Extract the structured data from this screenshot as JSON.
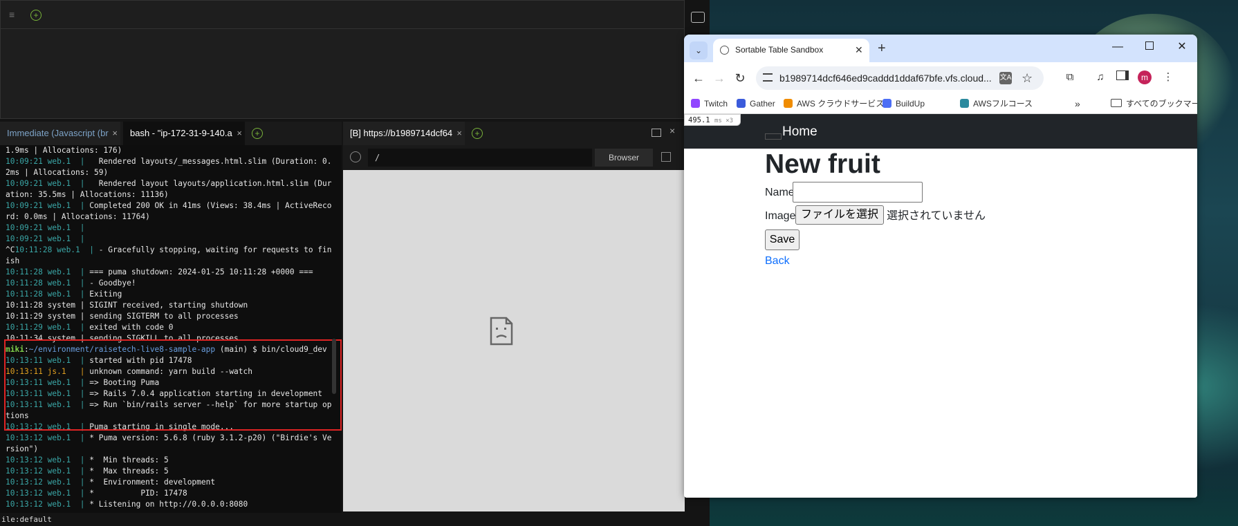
{
  "ide": {
    "terminal_tabs": [
      {
        "label": "Immediate (Javascript (br"
      },
      {
        "label": "bash - \"ip-172-31-9-140.a"
      }
    ],
    "close_glyph": "×",
    "add_glyph": "+",
    "menu_glyph": "≡",
    "status_text": "ile:default"
  },
  "terminal_lines": [
    {
      "parts": [
        {
          "t": "1.9ms | Allocations: 176)",
          "c": ""
        }
      ]
    },
    {
      "parts": [
        {
          "t": "10:09:21 web.1  | ",
          "c": "tcyan"
        },
        {
          "t": "  Rendered layouts/_messages.html.slim (Duration: 0.",
          "c": ""
        }
      ]
    },
    {
      "parts": [
        {
          "t": "2ms | Allocations: 59)",
          "c": ""
        }
      ]
    },
    {
      "parts": [
        {
          "t": "10:09:21 web.1  | ",
          "c": "tcyan"
        },
        {
          "t": "  Rendered layout layouts/application.html.slim (Dur",
          "c": ""
        }
      ]
    },
    {
      "parts": [
        {
          "t": "ation: 35.5ms | Allocations: 11136)",
          "c": ""
        }
      ]
    },
    {
      "parts": [
        {
          "t": "10:09:21 web.1  | ",
          "c": "tcyan"
        },
        {
          "t": "Completed 200 OK in 41ms (Views: 38.4ms | ActiveReco",
          "c": ""
        }
      ]
    },
    {
      "parts": [
        {
          "t": "rd: 0.0ms | Allocations: 11764)",
          "c": ""
        }
      ]
    },
    {
      "parts": [
        {
          "t": "10:09:21 web.1  |",
          "c": "tcyan"
        }
      ]
    },
    {
      "parts": [
        {
          "t": "10:09:21 web.1  |",
          "c": "tcyan"
        }
      ]
    },
    {
      "parts": [
        {
          "t": "^C",
          "c": ""
        },
        {
          "t": "10:11:28 web.1  | ",
          "c": "tcyan"
        },
        {
          "t": "- Gracefully stopping, waiting for requests to fin",
          "c": ""
        }
      ]
    },
    {
      "parts": [
        {
          "t": "ish",
          "c": ""
        }
      ]
    },
    {
      "parts": [
        {
          "t": "10:11:28 web.1  | ",
          "c": "tcyan"
        },
        {
          "t": "=== puma shutdown: 2024-01-25 10:11:28 +0000 ===",
          "c": ""
        }
      ]
    },
    {
      "parts": [
        {
          "t": "10:11:28 web.1  | ",
          "c": "tcyan"
        },
        {
          "t": "- Goodbye!",
          "c": ""
        }
      ]
    },
    {
      "parts": [
        {
          "t": "10:11:28 web.1  | ",
          "c": "tcyan"
        },
        {
          "t": "Exiting",
          "c": ""
        }
      ]
    },
    {
      "parts": [
        {
          "t": "10:11:28 system | SIGINT received, starting shutdown",
          "c": ""
        }
      ]
    },
    {
      "parts": [
        {
          "t": "10:11:29 system | sending SIGTERM to all processes",
          "c": ""
        }
      ]
    },
    {
      "parts": [
        {
          "t": "10:11:29 web.1  | ",
          "c": "tcyan"
        },
        {
          "t": "exited with code 0",
          "c": ""
        }
      ]
    },
    {
      "parts": [
        {
          "t": "10:11:34 system | sending SIGKILL to all processes",
          "c": ""
        }
      ]
    },
    {
      "parts": [
        {
          "t": "miki",
          "c": "tgreen"
        },
        {
          "t": ":",
          "c": ""
        },
        {
          "t": "~/environment/raisetech-live8-sample-app",
          "c": "tblue"
        },
        {
          "t": " (main) $ bin/cloud9_dev",
          "c": ""
        }
      ]
    },
    {
      "parts": [
        {
          "t": "10:13:11 web.1  | ",
          "c": "tcyan"
        },
        {
          "t": "started with pid 17478",
          "c": ""
        }
      ]
    },
    {
      "parts": [
        {
          "t": "10:13:11 js.1   | ",
          "c": "torange"
        },
        {
          "t": "unknown command: yarn build --watch",
          "c": ""
        }
      ]
    },
    {
      "parts": [
        {
          "t": "10:13:11 web.1  | ",
          "c": "tcyan"
        },
        {
          "t": "=> Booting Puma",
          "c": ""
        }
      ]
    },
    {
      "parts": [
        {
          "t": "10:13:11 web.1  | ",
          "c": "tcyan"
        },
        {
          "t": "=> Rails 7.0.4 application starting in development",
          "c": ""
        }
      ]
    },
    {
      "parts": [
        {
          "t": "10:13:11 web.1  | ",
          "c": "tcyan"
        },
        {
          "t": "=> Run `bin/rails server --help` for more startup op",
          "c": ""
        }
      ]
    },
    {
      "parts": [
        {
          "t": "tions",
          "c": ""
        }
      ]
    },
    {
      "parts": [
        {
          "t": "10:13:12 web.1  | ",
          "c": "tcyan"
        },
        {
          "t": "Puma starting in single mode...",
          "c": ""
        }
      ]
    },
    {
      "parts": [
        {
          "t": "10:13:12 web.1  | ",
          "c": "tcyan"
        },
        {
          "t": "* Puma version: 5.6.8 (ruby 3.1.2-p20) (\"Birdie's Ve",
          "c": ""
        }
      ]
    },
    {
      "parts": [
        {
          "t": "rsion\")",
          "c": ""
        }
      ]
    },
    {
      "parts": [
        {
          "t": "10:13:12 web.1  | ",
          "c": "tcyan"
        },
        {
          "t": "*  Min threads: 5",
          "c": ""
        }
      ]
    },
    {
      "parts": [
        {
          "t": "10:13:12 web.1  | ",
          "c": "tcyan"
        },
        {
          "t": "*  Max threads: 5",
          "c": ""
        }
      ]
    },
    {
      "parts": [
        {
          "t": "10:13:12 web.1  | ",
          "c": "tcyan"
        },
        {
          "t": "*  Environment: development",
          "c": ""
        }
      ]
    },
    {
      "parts": [
        {
          "t": "10:13:12 web.1  | ",
          "c": "tcyan"
        },
        {
          "t": "*          PID: 17478",
          "c": ""
        }
      ]
    },
    {
      "parts": [
        {
          "t": "10:13:12 web.1  | ",
          "c": "tcyan"
        },
        {
          "t": "* Listening on http://0.0.0.0:8080",
          "c": ""
        }
      ]
    }
  ],
  "preview": {
    "tab_label": "[B] https://b1989714dcf64",
    "url_value": "/",
    "browser_btn": "Browser"
  },
  "chrome": {
    "tab_title": "Sortable Table Sandbox",
    "address": "b1989714dcf646ed9caddd1ddaf67bfe.vfs.cloud...",
    "translate_glyph": "文A",
    "avatar_letter": "m",
    "tab_search_glyph": "⌄",
    "new_tab_glyph": "+",
    "minimize_glyph": "—",
    "close_glyph": "✕",
    "back_glyph": "←",
    "forward_glyph": "→",
    "reload_glyph": "↻",
    "star_glyph": "☆",
    "extensions_glyph": "⧉",
    "media_glyph": "♫",
    "menu_glyph": "⋮",
    "bookmarks": [
      {
        "label": "Twitch",
        "color": "#9146ff"
      },
      {
        "label": "Gather",
        "color": "#3b5bdb"
      },
      {
        "label": "AWS クラウドサービス...",
        "color": "#f08c00"
      },
      {
        "label": "BuildUp",
        "color": "#4c6ef5"
      },
      {
        "label": "AWSフルコース",
        "color": "#2b8a9e"
      }
    ],
    "bookmarks_more": "»",
    "all_bookmarks": "すべてのブックマーク"
  },
  "app": {
    "timing_value": "495.1",
    "timing_unit": "ms ×3",
    "nav_home": "Home",
    "heading": "New fruit",
    "name_label": "Name",
    "image_label": "Image",
    "file_button": "ファイルを選択",
    "file_status": "選択されていません",
    "save_button": "Save",
    "back_link": "Back"
  }
}
